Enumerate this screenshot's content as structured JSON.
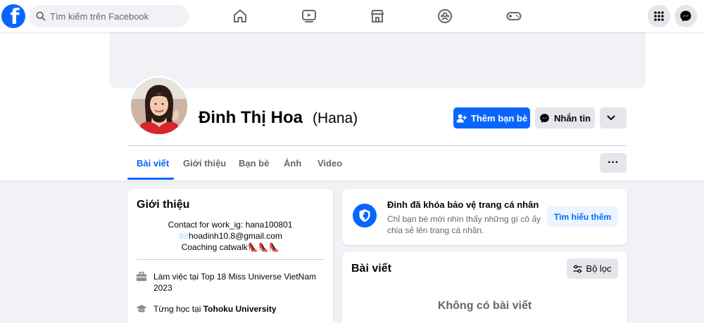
{
  "nav": {
    "search_placeholder": "Tìm kiếm trên Facebook",
    "logo_letter": "f",
    "icons": [
      "home-icon",
      "video-icon",
      "marketplace-icon",
      "groups-icon",
      "gaming-icon"
    ],
    "right_icons": [
      "menu-grid-icon",
      "messenger-icon"
    ]
  },
  "profile": {
    "name": "Đinh Thị Hoa",
    "alt_name": "(Hana)",
    "add_friend_label": "Thêm bạn bè",
    "message_label": "Nhắn tin",
    "more_label": "⌄"
  },
  "tabs": [
    {
      "label": "Bài viết",
      "active": true
    },
    {
      "label": "Giới thiệu",
      "active": false
    },
    {
      "label": "Bạn bè",
      "active": false
    },
    {
      "label": "Ảnh",
      "active": false
    },
    {
      "label": "Video",
      "active": false
    }
  ],
  "tabs_more_label": "···",
  "intro": {
    "title": "Giới thiệu",
    "bio_lines": [
      "Contact for work_ig: hana100801",
      "📨hoadinh10.8@gmail.com",
      "Coaching catwalk👠👠👠"
    ],
    "work_prefix": "Làm việc tại ",
    "work_place": "Top 18 Miss Universe VietNam 2023",
    "study_prefix": "Từng học tại ",
    "study_place": "Tohoku University"
  },
  "lock_notice": {
    "title": "Đinh đã khóa bảo vệ trang cá nhân",
    "description": "Chỉ bạn bè mới nhìn thấy những gì cô ấy chia sẻ lên trang cá nhân.",
    "learn_more_label": "Tìm hiểu thêm"
  },
  "posts": {
    "title": "Bài viết",
    "filter_label": "Bộ lọc",
    "empty_label": "Không có bài viết"
  },
  "colors": {
    "brand_blue": "#0866ff",
    "secondary_button": "#e4e6eb",
    "page_background": "#f0f2f5"
  }
}
